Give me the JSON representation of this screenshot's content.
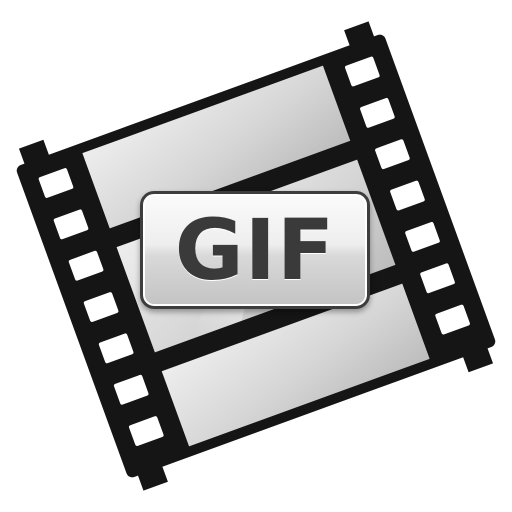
{
  "icon": {
    "name": "gif-film-strip-icon",
    "badge_text": "GIF"
  },
  "colors": {
    "film": "#151515",
    "frame_light": "#e3e3e3",
    "frame_mid": "#bdbdbd",
    "badge_text": "#3a3a3a",
    "background": "#ffffff"
  }
}
